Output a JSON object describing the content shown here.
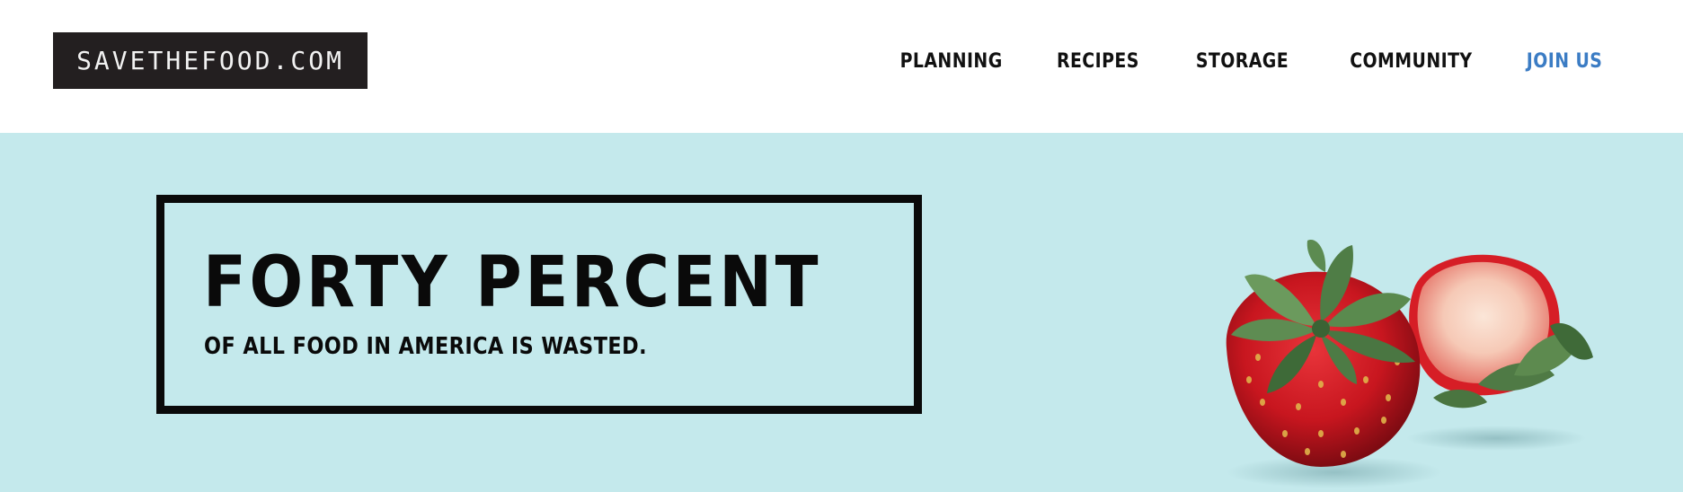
{
  "header": {
    "logo_text": "SAVETHEFOOD.COM",
    "nav": {
      "planning": "PLANNING",
      "recipes": "RECIPES",
      "storage": "STORAGE",
      "community": "COMMUNITY",
      "join": "JOIN US"
    }
  },
  "hero": {
    "headline": "FORTY PERCENT",
    "subline": "OF ALL FOOD IN AMERICA IS WASTED.",
    "image": "strawberries-image"
  },
  "colors": {
    "hero_background": "#c4e9ec",
    "logo_background": "#231f20",
    "join_link": "#3b7cc4",
    "text": "#0a0a0a"
  }
}
